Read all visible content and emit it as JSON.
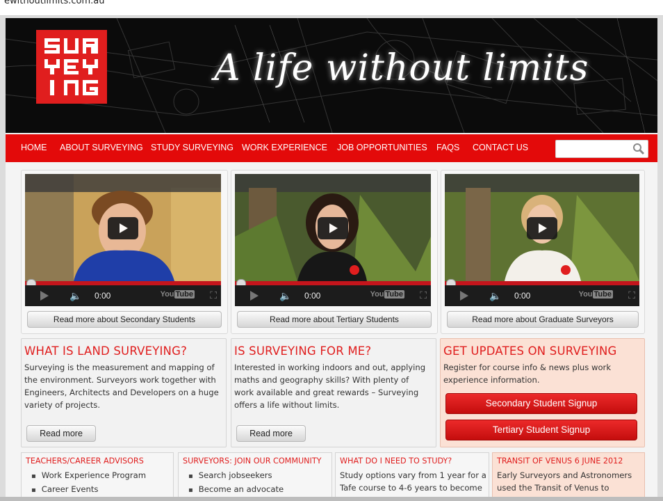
{
  "browser": {
    "url_fragment": "ewithoutlimits.com.au"
  },
  "banner": {
    "logo_letters": [
      "SUR",
      "VEY",
      "ING"
    ],
    "tagline": "A life without limits"
  },
  "nav": {
    "items": [
      "HOME",
      "ABOUT SURVEYING",
      "STUDY SURVEYING",
      "WORK EXPERIENCE",
      "JOB OPPORTUNITIES",
      "FAQS",
      "CONTACT US"
    ],
    "search_placeholder": ""
  },
  "videos": [
    {
      "time": "0:00",
      "button": "Read more about Secondary Students"
    },
    {
      "time": "0:00",
      "button": "Read more about Tertiary Students"
    },
    {
      "time": "0:00",
      "button": "Read more about Graduate Surveyors"
    }
  ],
  "youtube_label": "You",
  "youtube_label_box": "Tube",
  "panels": {
    "land": {
      "title": "WHAT IS LAND SURVEYING?",
      "body": "Surveying is the measurement and mapping of the environment. Surveyors work together with Engineers, Architects and Developers on a huge variety of projects.",
      "button": "Read more"
    },
    "forme": {
      "title": "IS SURVEYING FOR ME?",
      "body": "Interested in working indoors and out, applying maths and geography skills? With plenty of work available and great rewards – Surveying offers a life without limits.",
      "button": "Read more"
    },
    "updates": {
      "title": "GET UPDATES ON SURVEYING",
      "body": "Register for course info & news plus work experience information.",
      "button1": "Secondary Student Signup",
      "button2": "Tertiary Student Signup"
    }
  },
  "minis": {
    "teachers": {
      "title": "TEACHERS/CAREER ADVISORS",
      "items": [
        "Work Experience Program",
        "Career Events"
      ]
    },
    "community": {
      "title": "SURVEYORS: JOIN OUR COMMUNITY",
      "items": [
        "Search jobseekers",
        "Become an advocate"
      ]
    },
    "study": {
      "title": "WHAT DO I NEED TO STUDY?",
      "body": "Study options vary from 1 year for a Tafe course to 4-6 years to become"
    },
    "venus": {
      "title": "TRANSIT OF VENUS 6 JUNE 2012",
      "body": "Early Surveyors and Astronomers used the Transit of Venus to"
    }
  },
  "colors": {
    "brand_red": "#e01e1e",
    "nav_red": "#e30a0a",
    "panel_peach": "#fbe1d5"
  }
}
